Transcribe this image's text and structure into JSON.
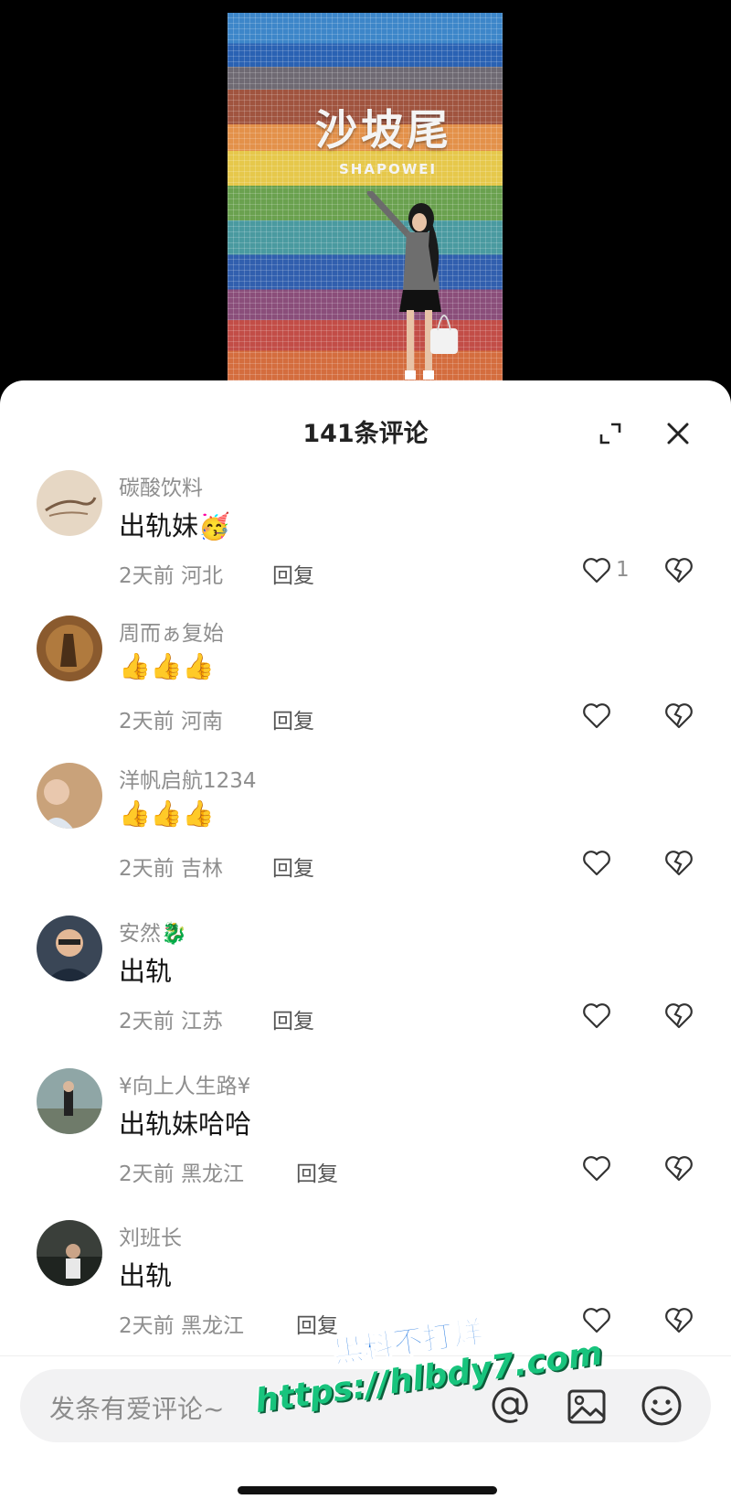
{
  "video": {
    "sign_cn": "沙坡尾",
    "sign_en": "SHAPOWEI"
  },
  "sheet": {
    "title": "141条评论",
    "expand_icon": "expand-icon",
    "close_icon": "close-icon"
  },
  "reply_label": "回复",
  "comments": [
    {
      "user": "碳酸饮料",
      "text": "出轨妹",
      "emoji": "🥳",
      "time": "2天前",
      "region": "河北",
      "likes": "1"
    },
    {
      "user": "周而ぁ复始",
      "text": "",
      "emoji": "👍👍👍",
      "time": "2天前",
      "region": "河南",
      "likes": ""
    },
    {
      "user": "洋帆启航1234",
      "text": "",
      "emoji": "👍👍👍",
      "time": "2天前",
      "region": "吉林",
      "likes": ""
    },
    {
      "user": "安然",
      "user_emoji": "🐉",
      "text": "出轨",
      "emoji": "",
      "time": "2天前",
      "region": "江苏",
      "likes": ""
    },
    {
      "user": "¥向上人生路¥",
      "text": "出轨妹哈哈",
      "emoji": "",
      "time": "2天前",
      "region": "黑龙江",
      "likes": ""
    },
    {
      "user": "刘班长",
      "text": "出轨",
      "emoji": "",
      "time": "2天前",
      "region": "黑龙江",
      "likes": ""
    }
  ],
  "input": {
    "placeholder": "发条有爱评论~",
    "at_icon": "at-icon",
    "image_icon": "image-icon",
    "emoji_icon": "emoji-face-icon"
  },
  "watermark": {
    "line1": "黑料不打烊",
    "line2": "https://hlbdy7.com"
  },
  "colors": {
    "sheet_bg": "#ffffff",
    "secondary_text": "#8e8e8e",
    "primary_text": "#161616",
    "input_bg": "#f2f2f3"
  }
}
